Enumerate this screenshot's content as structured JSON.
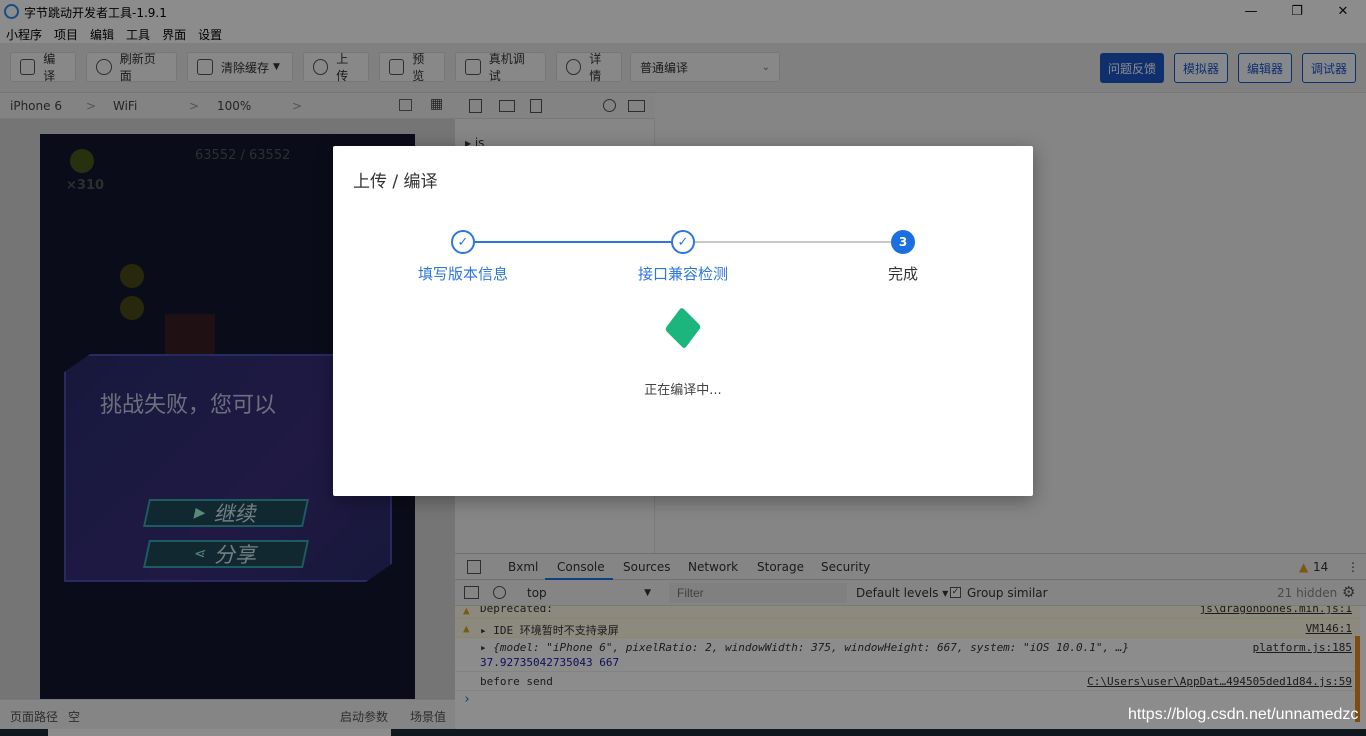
{
  "window": {
    "title": "字节跳动开发者工具-1.9.1"
  },
  "menu": [
    "小程序",
    "项目",
    "编辑",
    "工具",
    "界面",
    "设置"
  ],
  "toolbar": {
    "compile": "编译",
    "refresh": "刷新页面",
    "clear_cache": "清除缓存",
    "upload": "上传",
    "preview": "预览",
    "remote_debug": "真机调试",
    "details": "详情",
    "compile_mode": "普通编译",
    "feedback": "问题反馈",
    "simulator": "模拟器",
    "editor": "编辑器",
    "debugger": "调试器"
  },
  "device": {
    "model": "iPhone 6",
    "network": "WiFi",
    "zoom": "100%"
  },
  "game": {
    "score": "63552 / 63552",
    "multiplier": "×310",
    "fail_text": "挑战失败，您可以",
    "continue_label": "继续",
    "share_label": "分享"
  },
  "sim_footer": {
    "path_label": "页面路径",
    "path_value": "空",
    "launch_params": "启动参数",
    "scene_value": "场景值"
  },
  "filetree": {
    "item": "js"
  },
  "devtools": {
    "tabs": [
      "Bxml",
      "Console",
      "Sources",
      "Network",
      "Storage",
      "Security"
    ],
    "active_tab": "Console",
    "warn_count": "14",
    "context": "top",
    "filter_placeholder": "Filter",
    "levels": "Default levels",
    "group_similar": "Group similar",
    "hidden": "21 hidden",
    "logs": [
      {
        "text": "Deprecated:",
        "source": "js\\dragonbones.min.js:1",
        "level": "warn"
      },
      {
        "text": "IDE 环境暂时不支持录屏",
        "source": "VM146:1",
        "level": "warn"
      },
      {
        "text": "{model: \"iPhone 6\", pixelRatio: 2, windowWidth: 375, windowHeight: 667, system: \"iOS 10.0.1\", …}",
        "source": "platform.js:185",
        "level": "info"
      },
      {
        "text": "37.92735042735043 667",
        "source": "",
        "level": "info"
      },
      {
        "text": "before send",
        "source": "C:\\Users\\user\\AppDat…494505ded1d84.js:59",
        "level": "info"
      }
    ]
  },
  "modal": {
    "title": "上传 / 编译",
    "steps": [
      "填写版本信息",
      "接口兼容检测",
      "完成"
    ],
    "step3_number": "3",
    "status": "正在编译中..."
  },
  "watermark": "https://blog.csdn.net/unnamedzc",
  "colors": {
    "accent": "#1c56c7",
    "step_blue": "#2d76dc",
    "loader_green": "#1db57e"
  }
}
